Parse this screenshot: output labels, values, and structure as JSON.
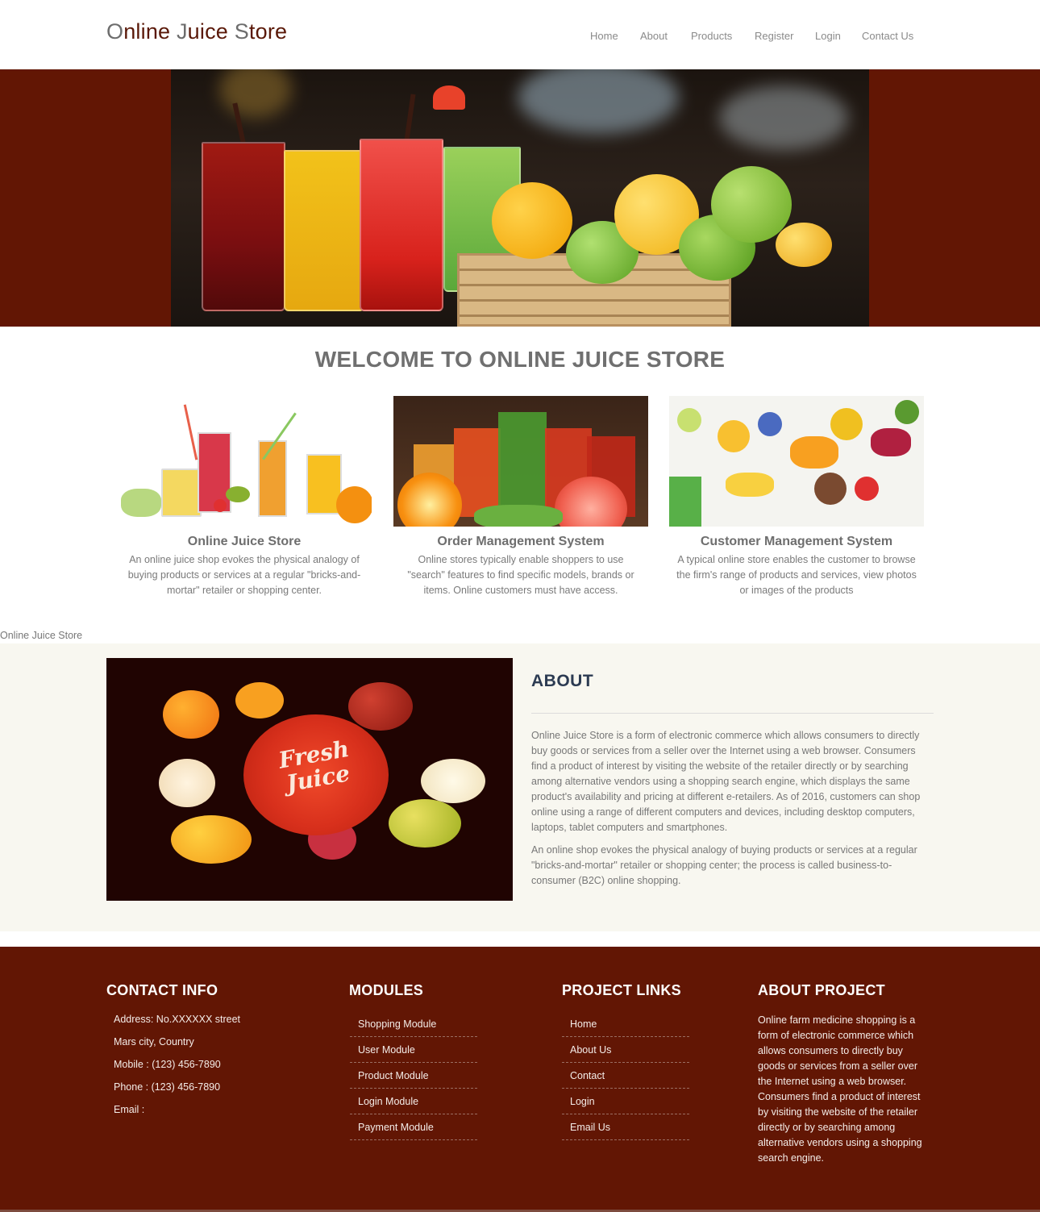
{
  "header": {
    "logo": {
      "parts": [
        {
          "cap": "O",
          "rest": "nline "
        },
        {
          "cap": "J",
          "rest": "uice "
        },
        {
          "cap": "S",
          "rest": "tore"
        }
      ]
    },
    "nav": [
      "Home",
      "About",
      "Products",
      "Register",
      "Login",
      "Contact Us"
    ]
  },
  "hero": {
    "image_alt": "Glasses of fresh juice with a crate of citrus fruit"
  },
  "welcome": {
    "title": "WELCOME TO ONLINE JUICE STORE"
  },
  "cards": [
    {
      "title": "Online Juice Store",
      "text": "An online juice shop evokes the physical analogy of buying products or services at a regular \"bricks-and-mortar\" retailer or shopping center.",
      "image_alt": "Juice glasses with fruit"
    },
    {
      "title": "Order Management System",
      "text": "Online stores typically enable shoppers to use \"search\" features to find specific models, brands or items. Online customers must have access.",
      "image_alt": "Vegetable and fruit juices"
    },
    {
      "title": "Customer Management System",
      "text": "A typical online store enables the customer to browse the firm's range of products and services, view photos or images of the products",
      "image_alt": "Sliced fruits on white background"
    }
  ],
  "stray_label": "Online Juice Store",
  "about": {
    "image_text_1": "Fresh",
    "image_text_2": "Juice",
    "title": "ABOUT",
    "paragraphs": [
      "Online Juice Store is a form of electronic commerce which allows consumers to directly buy goods or services from a seller over the Internet using a web browser. Consumers find a product of interest by visiting the website of the retailer directly or by searching among alternative vendors using a shopping search engine, which displays the same product's availability and pricing at different e-retailers. As of 2016, customers can shop online using a range of different computers and devices, including desktop computers, laptops, tablet computers and smartphones.",
      "An online shop evokes the physical analogy of buying products or services at a regular \"bricks-and-mortar\" retailer or shopping center; the process is called business-to-consumer (B2C) online shopping."
    ]
  },
  "footer": {
    "contact": {
      "title": "CONTACT INFO",
      "lines": [
        "Address: No.XXXXXX street",
        "Mars city, Country",
        "Mobile : (123) 456-7890",
        "Phone : (123) 456-7890",
        "Email :"
      ]
    },
    "modules": {
      "title": "MODULES",
      "items": [
        "Shopping Module",
        "User Module",
        "Product Module",
        "Login Module",
        "Payment Module"
      ]
    },
    "links": {
      "title": "PROJECT LINKS",
      "items": [
        "Home",
        "About Us",
        "Contact",
        "Login",
        "Email Us"
      ]
    },
    "about_project": {
      "title": "ABOUT PROJECT",
      "text": "Online farm medicine shopping is a form of electronic commerce which allows consumers to directly buy goods or services from a seller over the Internet using a web browser. Consumers find a product of interest by visiting the website of the retailer directly or by searching among alternative vendors using a shopping search engine."
    }
  },
  "colors": {
    "brand_maroon": "#621604",
    "about_bg": "#f8f7f0",
    "heading_navy": "#2c3b52"
  }
}
